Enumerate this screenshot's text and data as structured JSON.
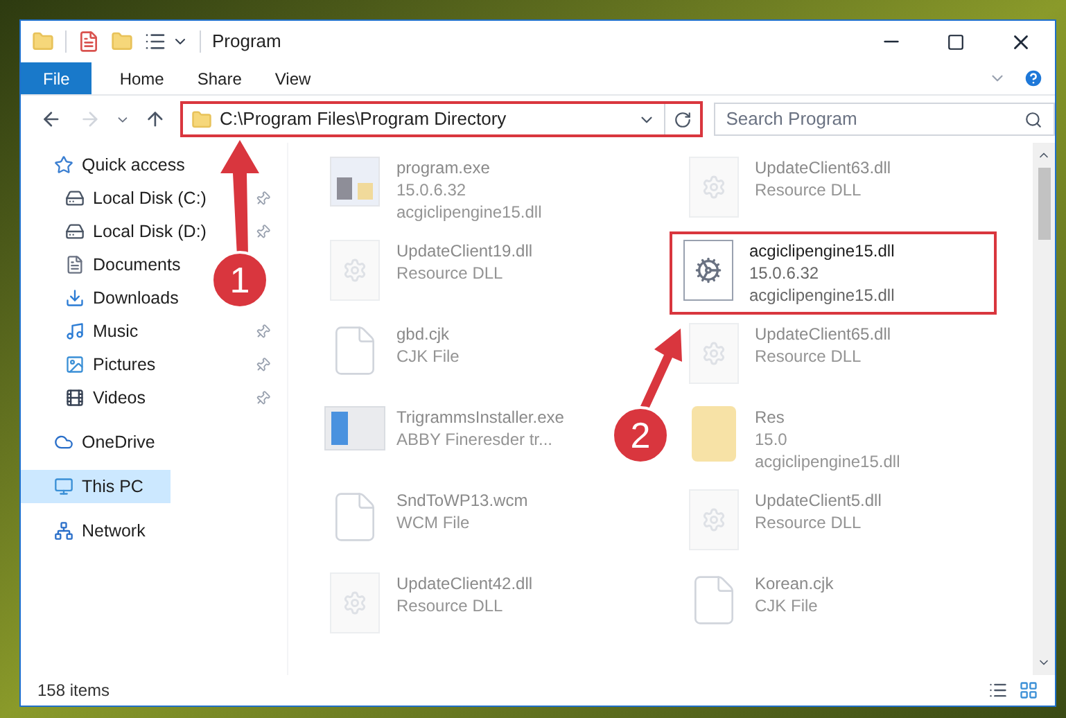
{
  "window": {
    "title": "Program"
  },
  "ribbon_tabs": [
    {
      "label": "File",
      "selected": true
    },
    {
      "label": "Home",
      "selected": false
    },
    {
      "label": "Share",
      "selected": false
    },
    {
      "label": "View",
      "selected": false
    }
  ],
  "address": {
    "path": "C:\\Program Files\\Program Directory",
    "highlighted": true
  },
  "search": {
    "placeholder": "Search Program"
  },
  "sidebar": {
    "items": [
      {
        "label": "Quick access",
        "kind": "star",
        "selected": false,
        "children": [
          {
            "label": "Local Disk (C:)",
            "kind": "drive",
            "pinned": true,
            "selected": false
          },
          {
            "label": "Local Disk (D:)",
            "kind": "drive",
            "pinned": true,
            "selected": false
          },
          {
            "label": "Documents",
            "kind": "documents",
            "pinned": false,
            "selected": false
          },
          {
            "label": "Downloads",
            "kind": "downloads",
            "pinned": false,
            "selected": false
          },
          {
            "label": "Music",
            "kind": "music",
            "pinned": true,
            "selected": false
          },
          {
            "label": "Pictures",
            "kind": "pictures",
            "pinned": true,
            "selected": false
          },
          {
            "label": "Videos",
            "kind": "videos",
            "pinned": true,
            "selected": false
          }
        ]
      },
      {
        "label": "OneDrive",
        "kind": "cloud",
        "selected": false
      },
      {
        "label": "This PC",
        "kind": "pc",
        "selected": true
      },
      {
        "label": "Network",
        "kind": "network",
        "selected": false
      }
    ]
  },
  "files": [
    {
      "name": "program.exe",
      "details": [
        "15.0.6.32",
        "acgiclipengine15.dll"
      ],
      "kind": "exe",
      "highlighted": false
    },
    {
      "name": "UpdateClient63.dll",
      "details": [
        "Resource DLL"
      ],
      "kind": "dll",
      "highlighted": false
    },
    {
      "name": "UpdateClient19.dll",
      "details": [
        "Resource DLL"
      ],
      "kind": "dll",
      "highlighted": false
    },
    {
      "name": "acgiclipengine15.dll",
      "details": [
        "15.0.6.32",
        "acgiclipengine15.dll"
      ],
      "kind": "gears",
      "highlighted": true
    },
    {
      "name": "gbd.cjk",
      "details": [
        "CJK File"
      ],
      "kind": "blank",
      "highlighted": false
    },
    {
      "name": "UpdateClient65.dll",
      "details": [
        "Resource DLL"
      ],
      "kind": "dll",
      "highlighted": false
    },
    {
      "name": "TrigrammsInstaller.exe",
      "details": [
        "ABBY Fineresder tr..."
      ],
      "kind": "installer",
      "highlighted": false
    },
    {
      "name": "Res",
      "details": [
        "15.0",
        "acgiclipengine15.dll"
      ],
      "kind": "archive",
      "highlighted": false
    },
    {
      "name": "SndToWP13.wcm",
      "details": [
        "WCM File"
      ],
      "kind": "blank",
      "highlighted": false
    },
    {
      "name": "UpdateClient5.dll",
      "details": [
        "Resource DLL"
      ],
      "kind": "dll",
      "highlighted": false
    },
    {
      "name": "UpdateClient42.dll",
      "details": [
        "Resource DLL"
      ],
      "kind": "dll",
      "highlighted": false
    },
    {
      "name": "Korean.cjk",
      "details": [
        "CJK File"
      ],
      "kind": "blank",
      "highlighted": false
    }
  ],
  "annotations": [
    {
      "label": "1"
    },
    {
      "label": "2"
    }
  ],
  "status_bar": {
    "count": "158 items"
  }
}
